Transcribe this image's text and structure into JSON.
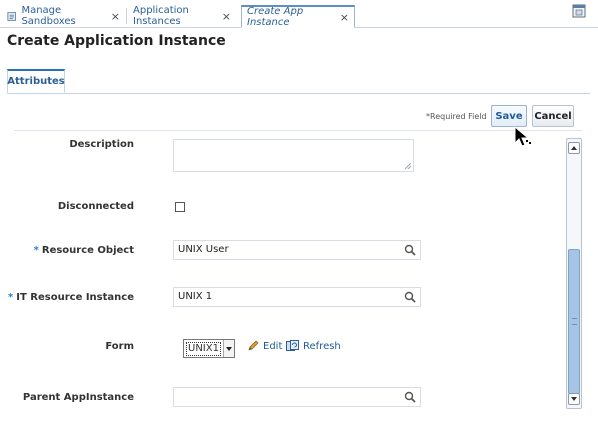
{
  "tabs": [
    {
      "label": "Manage Sandboxes",
      "close": "×"
    },
    {
      "label": "Application Instances",
      "close": "×"
    },
    {
      "label": "Create App Instance",
      "close": "×"
    }
  ],
  "page": {
    "title": "Create Application Instance"
  },
  "subtabs": [
    {
      "label": "Attributes"
    }
  ],
  "toolbar": {
    "required_label": "*Required Field",
    "save_label": "Save",
    "cancel_label": "Cancel"
  },
  "form": {
    "description": {
      "label": "Description",
      "value": ""
    },
    "disconnected": {
      "label": "Disconnected",
      "checked": false
    },
    "resource_object": {
      "label": "Resource Object",
      "required": "*",
      "value": "UNIX User"
    },
    "it_resource_instance": {
      "label": "IT Resource Instance",
      "required": "*",
      "value": "UNIX 1"
    },
    "form": {
      "label": "Form",
      "selected": "UNIX1",
      "edit_label": "Edit",
      "refresh_label": "Refresh"
    },
    "parent_appinstance": {
      "label": "Parent AppInstance",
      "value": ""
    }
  },
  "colors": {
    "accent": "#2b5f96",
    "required_star": "#2a7fd0",
    "scroll_thumb": "#a6c4e3"
  },
  "icons": [
    "document-icon",
    "close-icon",
    "window-icon",
    "search-icon",
    "pencil-icon",
    "refresh-icon",
    "chevron-down-icon",
    "mouse-cursor-icon"
  ]
}
